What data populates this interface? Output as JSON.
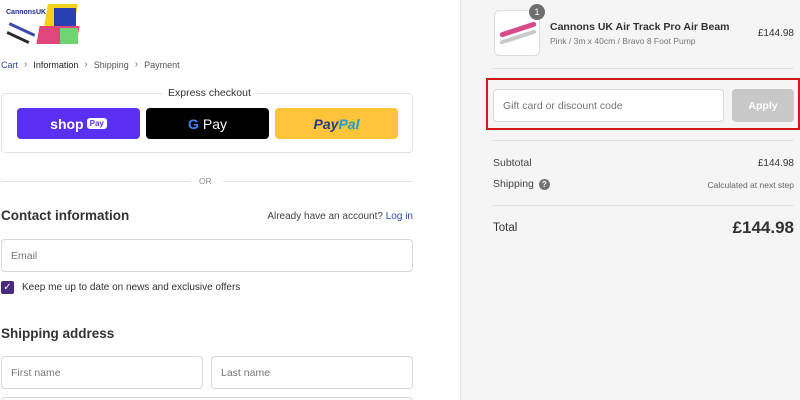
{
  "brand": {
    "logo_text": "CannonsUK"
  },
  "breadcrumb": {
    "items": [
      "Cart",
      "Information",
      "Shipping",
      "Payment"
    ]
  },
  "express": {
    "title": "Express checkout",
    "shop_label": "shop",
    "shop_pill": "Pay",
    "gpay_label": "Pay",
    "gpay_g": "G",
    "paypal_pay": "Pay",
    "paypal_pal": "Pal"
  },
  "divider": {
    "or": "OR"
  },
  "contact": {
    "heading": "Contact information",
    "account_prompt": "Already have an account?",
    "login_link": "Log in",
    "email_placeholder": "Email",
    "newsletter_label": "Keep me up to date on news and exclusive offers",
    "newsletter_checked": true
  },
  "shipping": {
    "heading": "Shipping address",
    "first_name_placeholder": "First name",
    "last_name_placeholder": "Last name"
  },
  "order": {
    "quantity": "1",
    "product_name": "Cannons UK Air Track Pro Air Beam",
    "variant": "Pink / 3m x 40cm / Bravo 8 Foot Pump",
    "price": "£144.98",
    "discount_placeholder": "Gift card or discount code",
    "apply_label": "Apply",
    "subtotal_label": "Subtotal",
    "subtotal_value": "£144.98",
    "shipping_label": "Shipping",
    "shipping_note": "Calculated at next step",
    "total_label": "Total",
    "total_value": "£144.98"
  },
  "colors": {
    "shop_pay": "#5a31f4",
    "paypal": "#ffc439",
    "link": "#2b49b8",
    "highlight": "#d11a1a",
    "checkbox": "#4a2a80"
  }
}
